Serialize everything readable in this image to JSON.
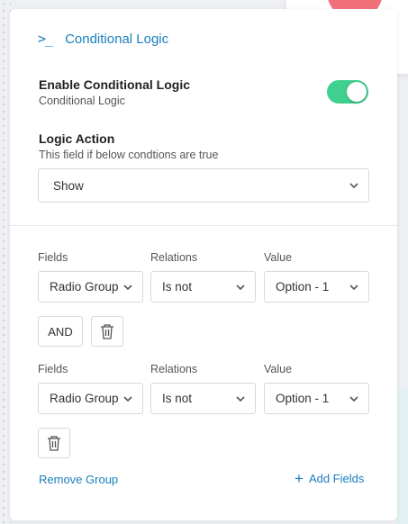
{
  "header": {
    "title": "Conditional Logic"
  },
  "enable": {
    "title": "Enable Conditional Logic",
    "subtitle": "Conditional Logic",
    "toggle_on": true
  },
  "logic_action": {
    "title": "Logic Action",
    "subtitle": "This field if below condtions are true",
    "selected": "Show"
  },
  "column_labels": {
    "fields": "Fields",
    "relations": "Relations",
    "value": "Value"
  },
  "conditions": [
    {
      "field": "Radio Group",
      "relation": "Is not",
      "value": "Option - 1"
    },
    {
      "field": "Radio Group",
      "relation": "Is not",
      "value": "Option - 1"
    }
  ],
  "and_label": "AND",
  "footer": {
    "remove_group": "Remove Group",
    "add_fields": "Add Fields"
  },
  "colors": {
    "accent": "#1a7fbf",
    "toggle": "#3fd08f"
  }
}
